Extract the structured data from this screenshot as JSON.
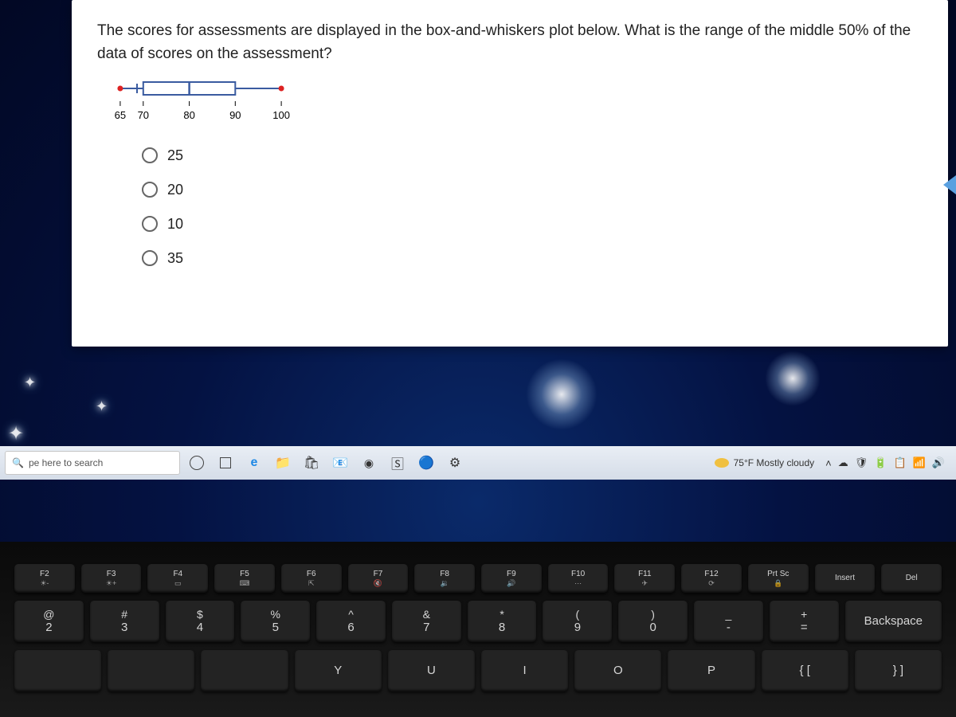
{
  "question": {
    "text": "The scores for assessments are displayed in the box-and-whiskers plot below. What is the range of the middle 50% of the data of scores on the assessment?"
  },
  "chart_data": {
    "type": "boxplot",
    "min": 65,
    "q1": 70,
    "median": 80,
    "q3": 90,
    "max": 100,
    "tick_labels": [
      "65",
      "70",
      "80",
      "90",
      "100"
    ],
    "xlim": [
      60,
      105
    ]
  },
  "options": [
    {
      "label": "25"
    },
    {
      "label": "20"
    },
    {
      "label": "10"
    },
    {
      "label": "35"
    }
  ],
  "taskbar": {
    "search_placeholder": "pe here to search",
    "weather": "75°F Mostly cloudy"
  },
  "keyboard": {
    "frow": [
      "F2",
      "F3",
      "F4",
      "F5",
      "F6",
      "F7",
      "F8",
      "F9",
      "F10",
      "F11",
      "F12",
      "Prt Sc",
      "Insert",
      "Del"
    ],
    "frow_icons": [
      "☀-",
      "☀+",
      "▭",
      "⌨",
      "⇱",
      "🔇",
      "🔉",
      "🔊",
      "⋯",
      "✈",
      "⟳",
      "🔒",
      "",
      ""
    ],
    "numrow_top": [
      "@",
      "#",
      "$",
      "%",
      "^",
      "&",
      "*",
      "(",
      ")",
      "_",
      "+",
      ""
    ],
    "numrow_bot": [
      "2",
      "3",
      "4",
      "5",
      "6",
      "7",
      "8",
      "9",
      "0",
      "-",
      "=",
      "Backspace"
    ],
    "row3": [
      "",
      "",
      "",
      "Y",
      "U",
      "I",
      "O",
      "P",
      "{  [",
      "}  ]"
    ]
  }
}
